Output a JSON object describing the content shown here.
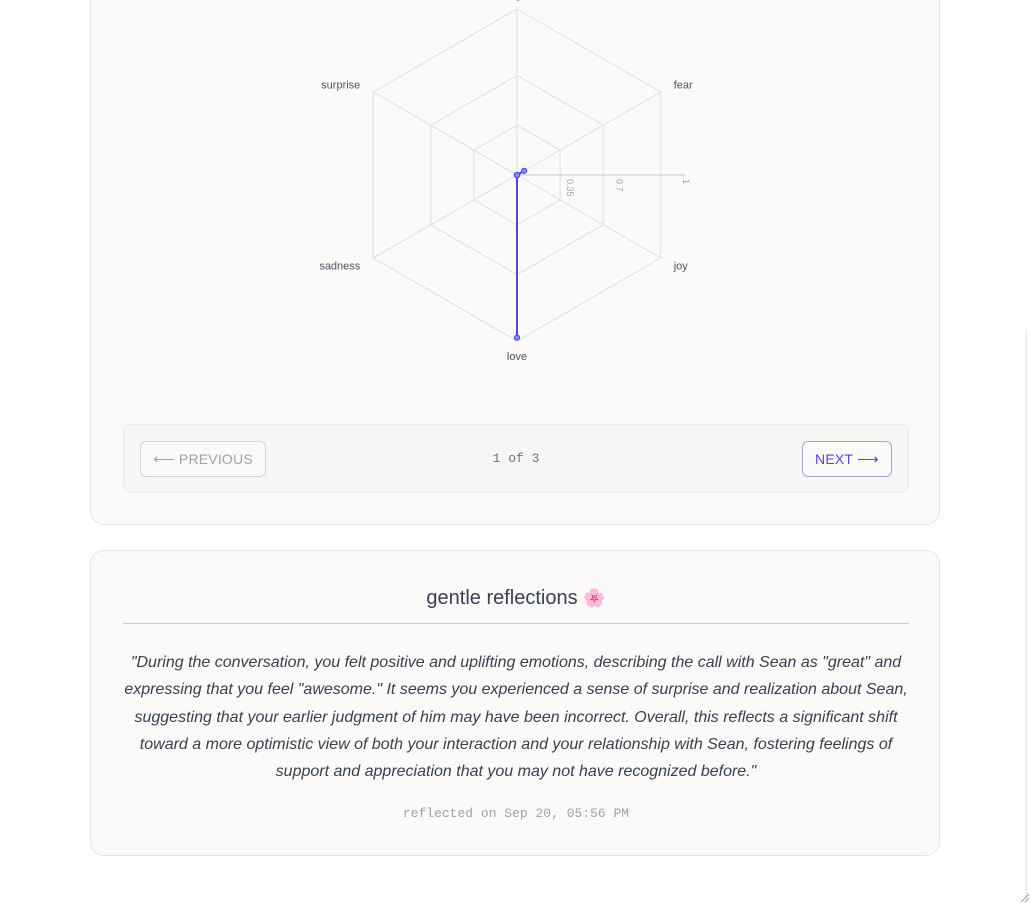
{
  "chart_data": {
    "type": "radar",
    "axes": [
      "anger",
      "fear",
      "joy",
      "love",
      "sadness",
      "surprise"
    ],
    "ticks": [
      "0.35",
      "0.7",
      "1"
    ],
    "range": [
      0,
      1
    ],
    "series": [
      {
        "values": [
          0.0,
          0.05,
          0.0,
          0.98,
          0.0,
          0.0
        ]
      }
    ],
    "colors": {
      "series": "#4f46e5",
      "grid": "#e2e0dc"
    }
  },
  "pager": {
    "prev_label": "PREVIOUS",
    "prev_arrow": "⟵",
    "next_label": "NEXT",
    "next_arrow": "⟶",
    "indicator": "1 of 3"
  },
  "reflection": {
    "title": "gentle reflections",
    "title_icon": "🌸",
    "body": "\"During the conversation, you felt positive and uplifting emotions, describing the call with Sean as \"great\" and expressing that you feel \"awesome.\" It seems you experienced a sense of surprise and realization about Sean, suggesting that your earlier judgment of him may have been incorrect. Overall, this reflects a significant shift toward a more optimistic view of both your interaction and your relationship with Sean, fostering feelings of support and appreciation that you may not have recognized before.\"",
    "timestamp": "reflected on Sep 20, 05:56 PM"
  }
}
